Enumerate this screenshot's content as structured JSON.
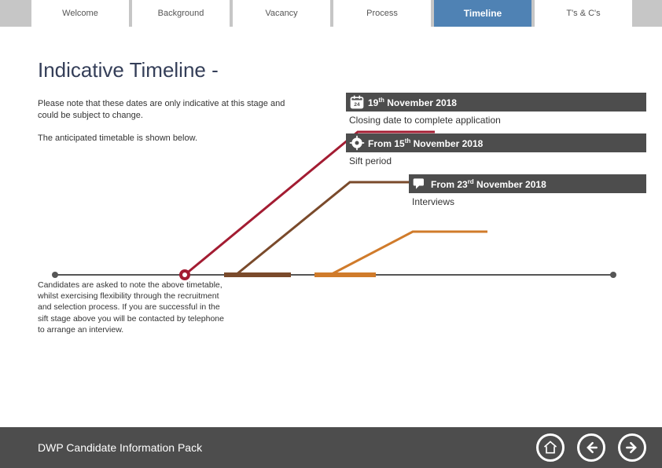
{
  "tabs": {
    "t0": "Welcome",
    "t1": "Background",
    "t2": "Vacancy",
    "t3": "Process",
    "t4": "Timeline",
    "t5": "T's & C's"
  },
  "heading": "Indicative Timeline -",
  "intro": "Please note that these dates are only indicative at this stage and could be subject to change.",
  "subintro": "The anticipated timetable is shown below.",
  "milestones": {
    "m1": {
      "date_pre": "19",
      "date_sup": "th",
      "date_post": " November 2018",
      "label": "Closing date to complete application"
    },
    "m2": {
      "date_pre": "From 15",
      "date_sup": "th",
      "date_post": " November 2018",
      "label": "Sift period"
    },
    "m3": {
      "date_pre": "From 23",
      "date_sup": "rd",
      "date_post": " November 2018",
      "label": "Interviews"
    }
  },
  "lower_note": "Candidates are asked to note the above timetable, whilst exercising flexibility through the recruitment and selection process. If you are successful in the sift stage above you will be contacted by telephone to arrange an interview.",
  "footer": {
    "title": "DWP Candidate Information Pack"
  },
  "colors": {
    "red": "#a31c32",
    "brown": "#7a4a2b",
    "orange": "#d07b2b"
  }
}
